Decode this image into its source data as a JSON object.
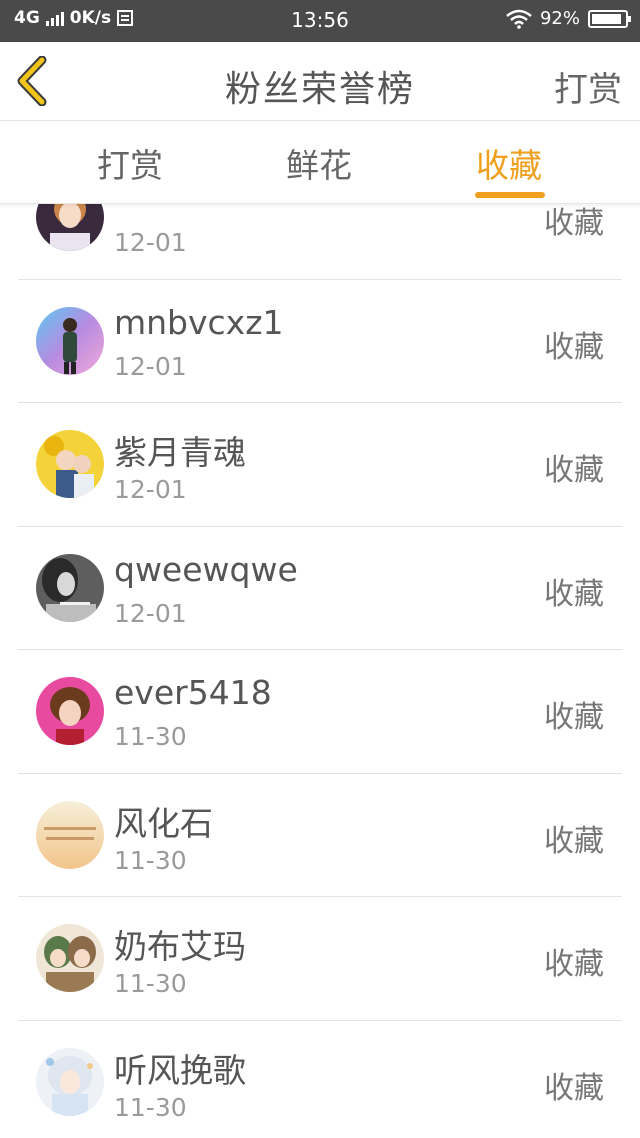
{
  "status_bar": {
    "network": "4G",
    "speed": "0K/s",
    "time": "13:56",
    "battery": "92%",
    "battery_level": 0.92,
    "icons": [
      "signal-icon",
      "data-icon",
      "wifi-icon",
      "battery-icon"
    ]
  },
  "header": {
    "title": "粉丝荣誉榜",
    "action": "打赏",
    "back_icon": "chevron-left-icon",
    "accent": "#f0c419"
  },
  "tabs": {
    "items": [
      {
        "label": "打赏",
        "active": false
      },
      {
        "label": "鲜花",
        "active": false
      },
      {
        "label": "收藏",
        "active": true
      }
    ],
    "active_color": "#f0a01e",
    "inactive_color": "#666666"
  },
  "list": {
    "items": [
      {
        "name": "",
        "date": "12-01",
        "action": "收藏"
      },
      {
        "name": "mnbvcxz1",
        "date": "12-01",
        "action": "收藏"
      },
      {
        "name": "紫月青魂",
        "date": "12-01",
        "action": "收藏"
      },
      {
        "name": "qweewqwe",
        "date": "12-01",
        "action": "收藏"
      },
      {
        "name": "ever5418",
        "date": "11-30",
        "action": "收藏"
      },
      {
        "name": "风化石",
        "date": "11-30",
        "action": "收藏"
      },
      {
        "name": "奶布艾玛",
        "date": "11-30",
        "action": "收藏"
      },
      {
        "name": "听风挽歌",
        "date": "11-30",
        "action": "收藏"
      }
    ]
  }
}
